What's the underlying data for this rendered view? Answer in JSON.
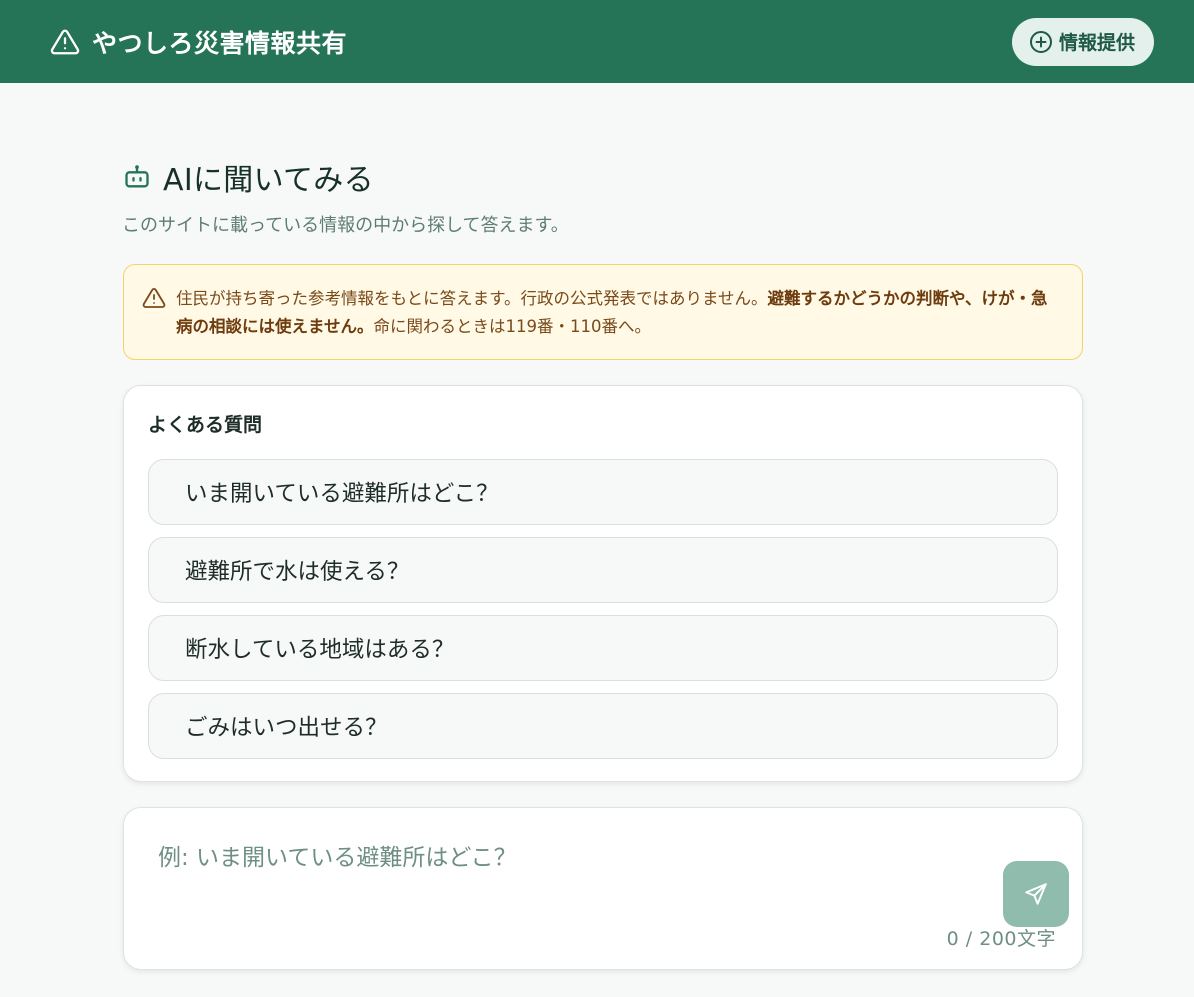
{
  "header": {
    "title": "やつしろ災害情報共有",
    "report_button_label": "情報提供"
  },
  "assistant": {
    "title": "AIに聞いてみる",
    "subtitle": "このサイトに載っている情報の中から探して答えます。"
  },
  "notice": {
    "text_plain_1": "住民が持ち寄った参考情報をもとに答えます。行政の公式発表ではありません。",
    "text_bold": "避難するかどうかの判断や、けが・急病の相談には使えません。",
    "text_plain_2": "命に関わるときは119番・110番へ。"
  },
  "faq": {
    "heading": "よくある質問",
    "items": [
      "いま開いている避難所はどこ？",
      "避難所で水は使える？",
      "断水している地域はある？",
      "ごみはいつ出せる？"
    ]
  },
  "composer": {
    "placeholder": "例: いま開いている避難所はどこ？",
    "value": "",
    "counter": "0 / 200文字"
  },
  "colors": {
    "header_bg": "#267458",
    "accent": "#267458",
    "notice_bg": "#fff9e6",
    "notice_border": "#f3d36b",
    "send_button": "#8fbcac"
  },
  "icons": {
    "brand": "warning-triangle-icon",
    "report": "plus-circle-icon",
    "assistant": "robot-icon",
    "notice": "warning-triangle-icon",
    "send": "paper-plane-icon"
  }
}
